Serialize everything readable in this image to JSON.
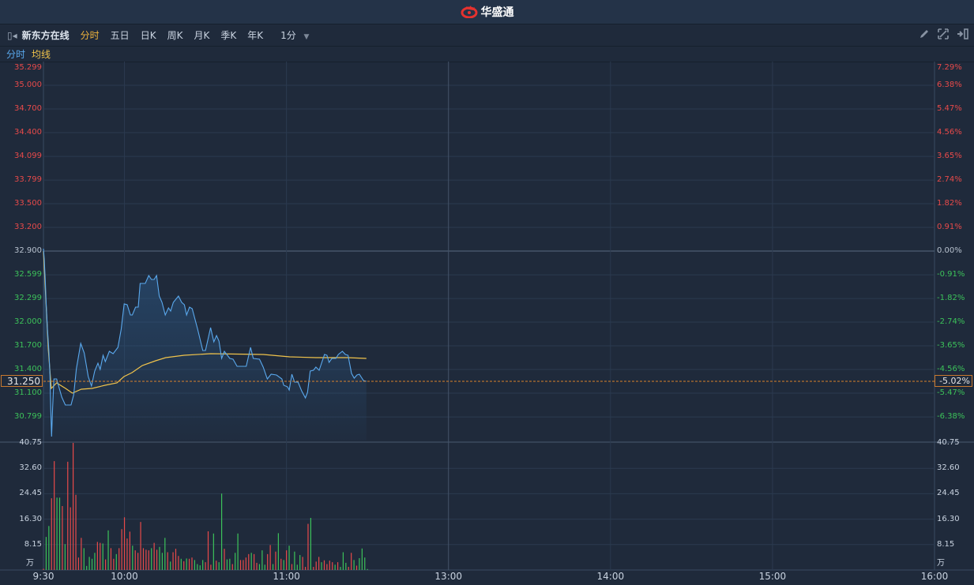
{
  "app": {
    "title": "华盛通",
    "logo_icon": "flame-swirl-logo"
  },
  "toolbar": {
    "stock_name": "新东方在线",
    "tabs": [
      "分时",
      "五日",
      "日K",
      "周K",
      "月K",
      "季K",
      "年K"
    ],
    "active_tab": "分时",
    "interval": "1分",
    "icons": [
      "collapse-left-icon",
      "pencil-icon",
      "fullscreen-icon",
      "exit-icon"
    ]
  },
  "legend": {
    "price_label": "分时",
    "avg_label": "均线"
  },
  "current": {
    "price": "31.250",
    "change": "-5.02%"
  },
  "colors": {
    "price_line": "#5aa9ee",
    "avg_line": "#f0c34b",
    "up": "#e84a4a",
    "down": "#3cc25a",
    "grid": "#2b3a4f"
  },
  "chart_data": {
    "type": "line",
    "title": "新东方在线 分时",
    "prev_close": 32.9,
    "price_axis": {
      "ylim": [
        30.5,
        35.3
      ],
      "ticks": [
        {
          "price": 35.299,
          "label": "35.299",
          "pct": "7.29%"
        },
        {
          "price": 35.0,
          "label": "35.000",
          "pct": "6.38%"
        },
        {
          "price": 34.7,
          "label": "34.700",
          "pct": "5.47%"
        },
        {
          "price": 34.4,
          "label": "34.400",
          "pct": "4.56%"
        },
        {
          "price": 34.099,
          "label": "34.099",
          "pct": "3.65%"
        },
        {
          "price": 33.799,
          "label": "33.799",
          "pct": "2.74%"
        },
        {
          "price": 33.5,
          "label": "33.500",
          "pct": "1.82%"
        },
        {
          "price": 33.2,
          "label": "33.200",
          "pct": "0.91%"
        },
        {
          "price": 32.9,
          "label": "32.900",
          "pct": "0.00%"
        },
        {
          "price": 32.599,
          "label": "32.599",
          "pct": "-0.91%"
        },
        {
          "price": 32.299,
          "label": "32.299",
          "pct": "-1.82%"
        },
        {
          "price": 32.0,
          "label": "32.000",
          "pct": "-2.74%"
        },
        {
          "price": 31.7,
          "label": "31.700",
          "pct": "-3.65%"
        },
        {
          "price": 31.4,
          "label": "31.400",
          "pct": "-4.56%"
        },
        {
          "price": 31.1,
          "label": "31.100",
          "pct": "-5.47%"
        },
        {
          "price": 30.799,
          "label": "30.799",
          "pct": "-6.38%"
        }
      ]
    },
    "volume_axis": {
      "unit": "万",
      "ylim": [
        0,
        40.75
      ],
      "ticks": [
        {
          "v": 40.75,
          "label": "40.75"
        },
        {
          "v": 32.6,
          "label": "32.60"
        },
        {
          "v": 24.45,
          "label": "24.45"
        },
        {
          "v": 16.3,
          "label": "16.30"
        },
        {
          "v": 8.15,
          "label": "8.15"
        }
      ]
    },
    "x_axis": {
      "total_minutes": 330,
      "ticks": [
        {
          "label": "9:30",
          "min": 0
        },
        {
          "label": "10:00",
          "min": 30
        },
        {
          "label": "11:00",
          "min": 90
        },
        {
          "label": "13:00",
          "min": 150
        },
        {
          "label": "14:00",
          "min": 210
        },
        {
          "label": "15:00",
          "min": 270
        },
        {
          "label": "16:00",
          "min": 330
        }
      ]
    },
    "series": [
      {
        "name": "分时",
        "points": [
          [
            0,
            32.93
          ],
          [
            0.3,
            32.8
          ],
          [
            0.7,
            32.51
          ],
          [
            1,
            32.25
          ],
          [
            1.5,
            31.91
          ],
          [
            2,
            31.65
          ],
          [
            2.4,
            31.35
          ],
          [
            2.7,
            30.91
          ],
          [
            3,
            30.55
          ],
          [
            3.4,
            30.91
          ],
          [
            3.9,
            31.28
          ],
          [
            4.9,
            31.28
          ],
          [
            6.8,
            31.05
          ],
          [
            8.1,
            30.95
          ],
          [
            10.2,
            30.95
          ],
          [
            11.2,
            31.08
          ],
          [
            12.2,
            31.41
          ],
          [
            13.8,
            31.73
          ],
          [
            15.1,
            31.61
          ],
          [
            16.6,
            31.31
          ],
          [
            17.8,
            31.19
          ],
          [
            19,
            31.38
          ],
          [
            20.2,
            31.48
          ],
          [
            21,
            31.4
          ],
          [
            22.1,
            31.58
          ],
          [
            22.9,
            31.5
          ],
          [
            24.4,
            31.63
          ],
          [
            25.8,
            31.6
          ],
          [
            27.6,
            31.68
          ],
          [
            28.8,
            31.91
          ],
          [
            29.9,
            32.23
          ],
          [
            31,
            32.22
          ],
          [
            32.2,
            32.09
          ],
          [
            32.9,
            32.09
          ],
          [
            34.1,
            32.19
          ],
          [
            35.1,
            32.19
          ],
          [
            35.8,
            32.49
          ],
          [
            37.7,
            32.49
          ],
          [
            39,
            32.59
          ],
          [
            40,
            32.54
          ],
          [
            41,
            32.54
          ],
          [
            41.9,
            32.59
          ],
          [
            42.9,
            32.33
          ],
          [
            43.9,
            32.25
          ],
          [
            45.1,
            32.09
          ],
          [
            46.3,
            32.18
          ],
          [
            47.1,
            32.14
          ],
          [
            48.1,
            32.25
          ],
          [
            50,
            32.33
          ],
          [
            51.2,
            32.25
          ],
          [
            52.2,
            32.22
          ],
          [
            53,
            32.09
          ],
          [
            54.1,
            32.19
          ],
          [
            55.1,
            32.17
          ],
          [
            57.1,
            31.91
          ],
          [
            59,
            31.64
          ],
          [
            60,
            31.64
          ],
          [
            61.9,
            31.93
          ],
          [
            63.1,
            31.75
          ],
          [
            64.1,
            31.83
          ],
          [
            65,
            31.76
          ],
          [
            66,
            31.54
          ],
          [
            67,
            31.63
          ],
          [
            69,
            31.54
          ],
          [
            70.2,
            31.53
          ],
          [
            71.7,
            31.44
          ],
          [
            75.1,
            31.44
          ],
          [
            76.7,
            31.68
          ],
          [
            77.7,
            31.54
          ],
          [
            80,
            31.53
          ],
          [
            81.4,
            31.43
          ],
          [
            82.9,
            31.28
          ],
          [
            84.3,
            31.34
          ],
          [
            86.3,
            31.33
          ],
          [
            88.3,
            31.28
          ],
          [
            89,
            31.2
          ],
          [
            90.4,
            31.18
          ],
          [
            91,
            31.14
          ],
          [
            92,
            31.34
          ],
          [
            93,
            31.24
          ],
          [
            94.3,
            31.24
          ],
          [
            95.6,
            31.13
          ],
          [
            97,
            31.04
          ],
          [
            97.8,
            31.11
          ],
          [
            98.8,
            31.38
          ],
          [
            100,
            31.39
          ],
          [
            100.9,
            31.43
          ],
          [
            102.1,
            31.39
          ],
          [
            104.1,
            31.59
          ],
          [
            105,
            31.58
          ],
          [
            105.8,
            31.49
          ],
          [
            106.8,
            31.54
          ],
          [
            108.3,
            31.54
          ],
          [
            109.2,
            31.59
          ],
          [
            110.7,
            31.63
          ],
          [
            111.8,
            31.59
          ],
          [
            112.8,
            31.58
          ],
          [
            114.1,
            31.35
          ],
          [
            115.1,
            31.29
          ],
          [
            116.1,
            31.33
          ],
          [
            117,
            31.34
          ],
          [
            118.5,
            31.26
          ],
          [
            119.6,
            31.25
          ]
        ]
      },
      {
        "name": "均线",
        "points": [
          [
            0,
            32.9
          ],
          [
            1.8,
            31.65
          ],
          [
            2.9,
            31.16
          ],
          [
            4.9,
            31.23
          ],
          [
            8.2,
            31.16
          ],
          [
            10.7,
            31.1
          ],
          [
            14,
            31.15
          ],
          [
            18,
            31.16
          ],
          [
            22.8,
            31.2
          ],
          [
            27.2,
            31.23
          ],
          [
            29.8,
            31.31
          ],
          [
            32.8,
            31.36
          ],
          [
            36.6,
            31.45
          ],
          [
            41.5,
            31.51
          ],
          [
            45.3,
            31.55
          ],
          [
            52.1,
            31.58
          ],
          [
            61.9,
            31.6
          ],
          [
            81.4,
            31.59
          ],
          [
            91.2,
            31.56
          ],
          [
            100.9,
            31.55
          ],
          [
            112.6,
            31.55
          ],
          [
            119.6,
            31.54
          ]
        ]
      }
    ],
    "volume": {
      "values": [
        0.4,
        10.6,
        14.1,
        23,
        34.9,
        23.2,
        23.2,
        20.5,
        8.3,
        34.7,
        20.1,
        40.75,
        24.1,
        4,
        10.3,
        7,
        1.3,
        4.2,
        3.6,
        5.5,
        9,
        8.7,
        8.5,
        3.4,
        12.7,
        7,
        3.6,
        5.1,
        7,
        13.1,
        16.9,
        10.1,
        12.3,
        7.8,
        6.3,
        5.5,
        15.4,
        7,
        6.5,
        6.3,
        7,
        8.7,
        6.5,
        7.4,
        5.5,
        10.3,
        5.7,
        2.7,
        5.7,
        6.8,
        4.5,
        3.6,
        2.8,
        3.7,
        3.6,
        4,
        3.2,
        1.9,
        1.5,
        3.2,
        2.5,
        12.4,
        1.7,
        11.7,
        3,
        2.5,
        24.5,
        6.8,
        3.4,
        3.6,
        1.9,
        5.5,
        11.7,
        3.2,
        3.2,
        4,
        5.1,
        5.5,
        5.1,
        2.3,
        1.9,
        6.3,
        1.7,
        5.1,
        8,
        1.9,
        5.9,
        11.8,
        3.6,
        3.2,
        6.3,
        7.8,
        1.9,
        5.9,
        1.7,
        4.8,
        4.2,
        1,
        14.8,
        16.7,
        1,
        2.7,
        4.2,
        2.5,
        3.1,
        1.9,
        3,
        2.5,
        1.7,
        2.5,
        1,
        5.7,
        2.3,
        1,
        5.5,
        3.2,
        1.4,
        3.8,
        6.9,
        4,
        0.3
      ],
      "direction": "rggrrggrgrrrrrrgggggrrgrgrrgrrrrrgrrrrrrgrrgggrgrrrgrgrrggggrrrgrggrggrggrrrrgrrgggrrgrgrgrgrgggrrrgrrrgrrrrgrgggrrgr"
    }
  }
}
